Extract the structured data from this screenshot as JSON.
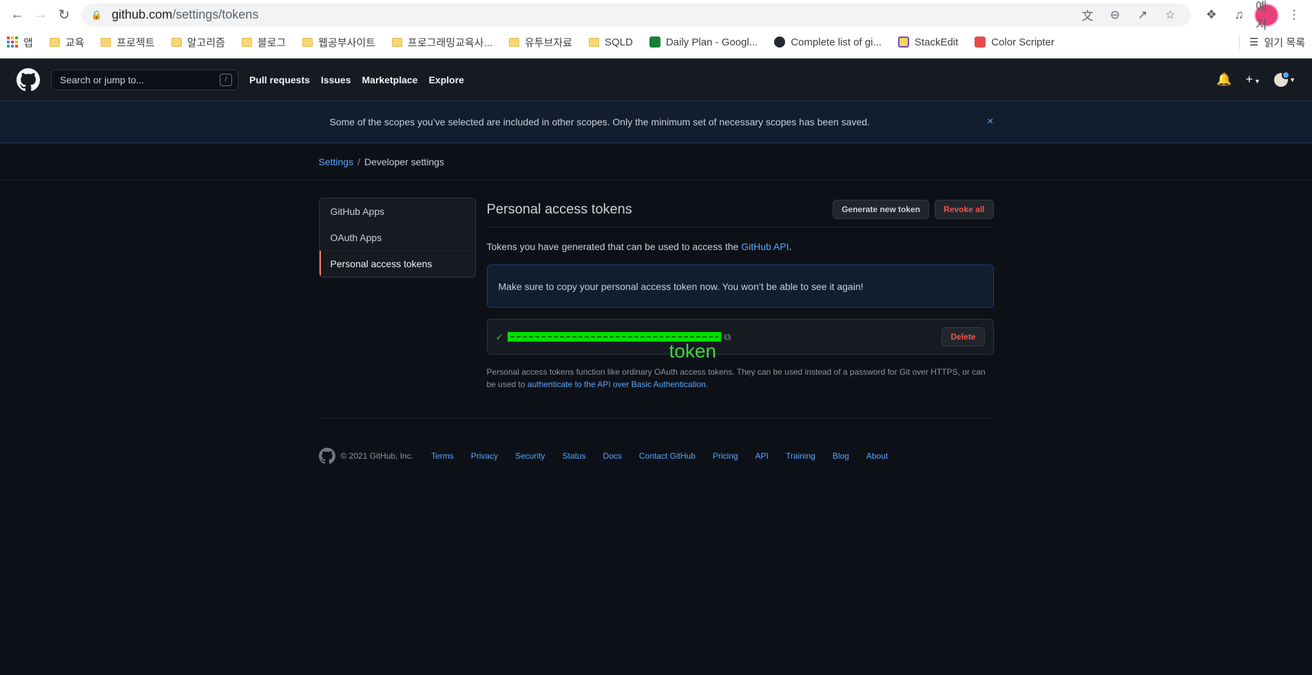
{
  "browser": {
    "url_host": "github.com",
    "url_path": "/settings/tokens",
    "profile_label": "예지",
    "bookmarks": [
      {
        "label": "앱",
        "kind": "apps"
      },
      {
        "label": "교육",
        "kind": "folder"
      },
      {
        "label": "프로젝트",
        "kind": "folder"
      },
      {
        "label": "알고리즘",
        "kind": "folder"
      },
      {
        "label": "블로그",
        "kind": "folder"
      },
      {
        "label": "웹공부사이트",
        "kind": "folder"
      },
      {
        "label": "프로그래밍교육사...",
        "kind": "folder"
      },
      {
        "label": "유투브자료",
        "kind": "folder"
      },
      {
        "label": "SQLD",
        "kind": "folder"
      },
      {
        "label": "Daily Plan - Googl...",
        "kind": "sheets"
      },
      {
        "label": "Complete list of gi...",
        "kind": "github"
      },
      {
        "label": "StackEdit",
        "kind": "stackedit"
      },
      {
        "label": "Color Scripter",
        "kind": "colorscripter"
      }
    ],
    "reading_list": "읽기 목록"
  },
  "header": {
    "search_placeholder": "Search or jump to...",
    "search_shortcut": "/",
    "nav": [
      "Pull requests",
      "Issues",
      "Marketplace",
      "Explore"
    ]
  },
  "flash": {
    "message": "Some of the scopes you’ve selected are included in other scopes. Only the minimum set of necessary scopes has been saved.",
    "close": "×"
  },
  "breadcrumb": {
    "root": "Settings",
    "separator": "/",
    "current": "Developer settings"
  },
  "sidebar": {
    "items": [
      "GitHub Apps",
      "OAuth Apps",
      "Personal access tokens"
    ]
  },
  "main": {
    "title": "Personal access tokens",
    "generate_btn": "Generate new token",
    "revoke_btn": "Revoke all",
    "intro_text": "Tokens you have generated that can be used to access the ",
    "intro_link": "GitHub API",
    "intro_end": ".",
    "notice": "Make sure to copy your personal access token now. You won’t be able to see it again!",
    "token_annotation": "token",
    "delete_btn": "Delete",
    "help_text": "Personal access tokens function like ordinary OAuth access tokens. They can be used instead of a password for Git over HTTPS, or can be used to ",
    "help_link": "authenticate to the API over Basic Authentication",
    "help_end": "."
  },
  "footer": {
    "copyright": "© 2021 GitHub, Inc.",
    "links": [
      "Terms",
      "Privacy",
      "Security",
      "Status",
      "Docs",
      "Contact GitHub",
      "Pricing",
      "API",
      "Training",
      "Blog",
      "About"
    ]
  },
  "colors": {
    "page_bg": "#0d1117",
    "header_bg": "#161b22",
    "link": "#58a6ff",
    "danger": "#f85149",
    "active_tab_accent": "#f78166",
    "redaction_green": "#00e000"
  }
}
